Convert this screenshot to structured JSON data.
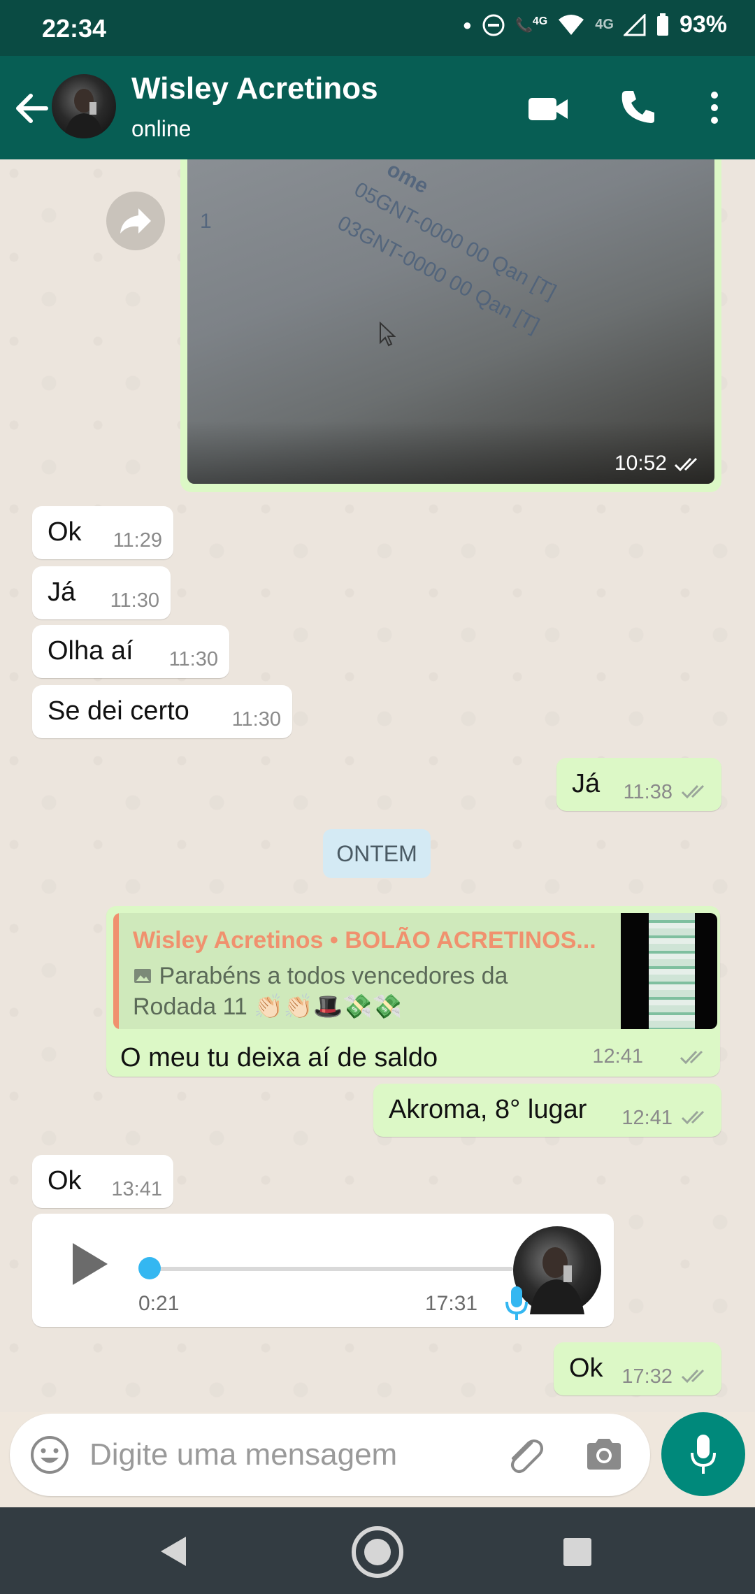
{
  "status_bar": {
    "time": "22:34",
    "battery": "93%",
    "net1": "4G",
    "net2": "4G"
  },
  "header": {
    "contact_name": "Wisley Acretinos",
    "status": "online"
  },
  "image_message": {
    "time": "10:52",
    "photo_line1": "ome",
    "photo_line2": "05GNT-0000 00 Qan [T]",
    "photo_line3": "03GNT-0000 00 Qan [T]",
    "photo_line4": "1"
  },
  "messages": [
    {
      "text": "Ok",
      "time": "11:29"
    },
    {
      "text": "Já",
      "time": "11:30"
    },
    {
      "text": "Olha aí",
      "time": "11:30"
    },
    {
      "text": "Se dei certo",
      "time": "11:30"
    },
    {
      "text": "Já",
      "time": "11:38"
    },
    {
      "text": "Akroma, 8° lugar",
      "time": "12:41"
    },
    {
      "text": "Ok",
      "time": "13:41"
    },
    {
      "text": "Ok",
      "time": "17:32"
    }
  ],
  "date_divider": "ONTEM",
  "reply_message": {
    "quote_author": "Wisley Acretinos • BOLÃO ACRETINOS...",
    "quote_text": "Parabéns a todos vencedores da Rodada 11",
    "quote_emoji": "👏🏻👏🏻🎩💸💸",
    "text": "O meu tu deixa aí de saldo",
    "time": "12:41"
  },
  "voice_message": {
    "duration": "0:21",
    "time": "17:31",
    "progress": 0
  },
  "input": {
    "placeholder": "Digite uma mensagem"
  },
  "colors": {
    "header": "#075e54",
    "statusbar": "#0a4b43",
    "outgoing": "#dcf8c6",
    "incoming": "#ffffff",
    "accent": "#00897b",
    "ticks": "#9aa59a"
  },
  "icons": [
    "back-arrow-icon",
    "video-call-icon",
    "phone-icon",
    "more-options-icon",
    "forward-icon",
    "double-check-icon",
    "play-icon",
    "mic-icon",
    "emoji-icon",
    "attach-icon",
    "camera-icon",
    "nav-back-icon",
    "nav-home-icon",
    "nav-recents-icon"
  ]
}
